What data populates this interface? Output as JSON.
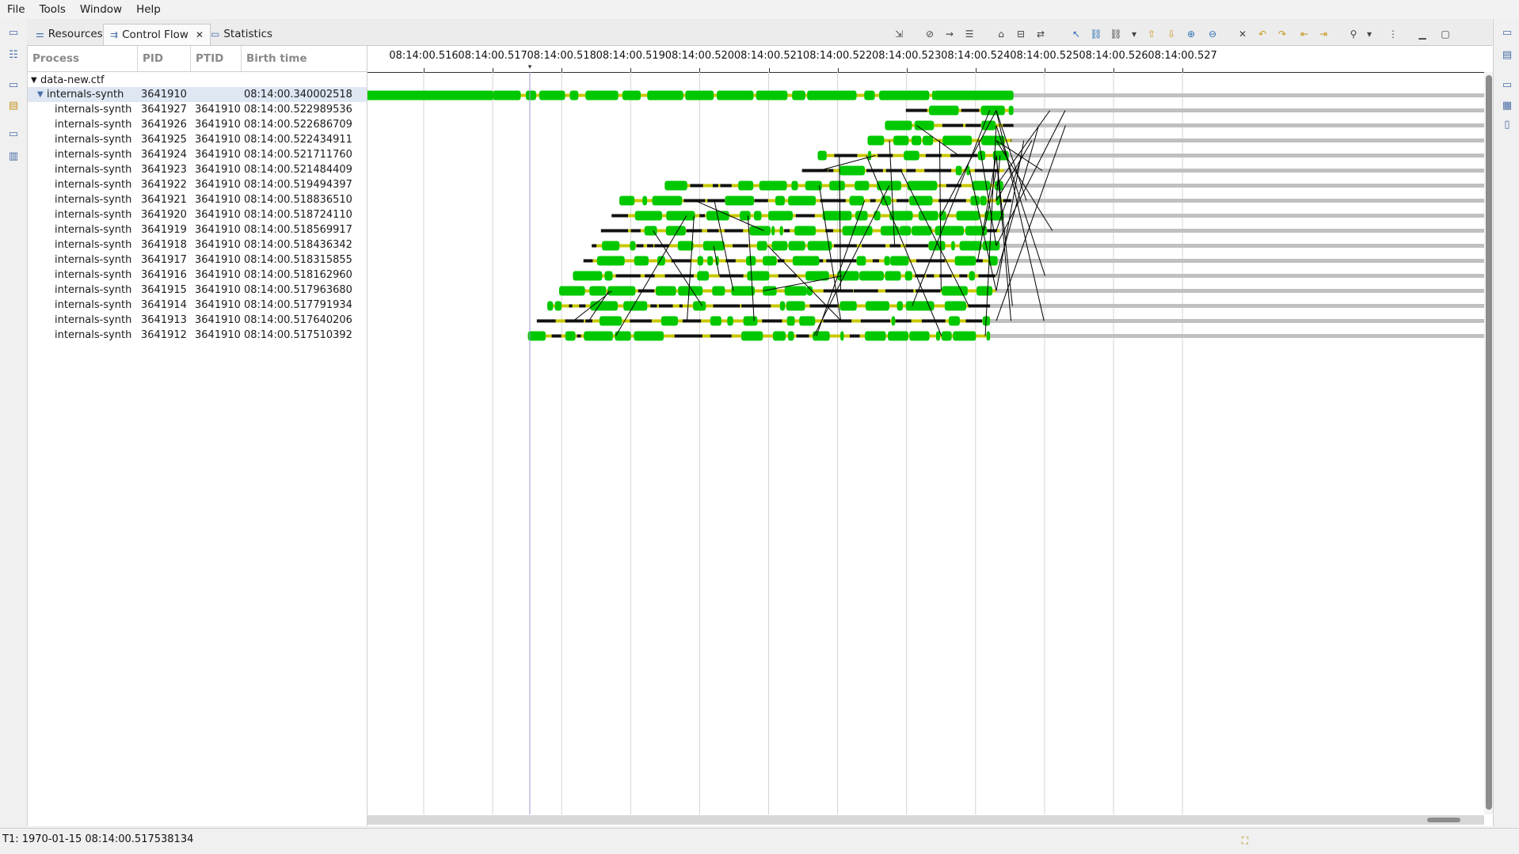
{
  "menu": [
    "File",
    "Tools",
    "Window",
    "Help"
  ],
  "tabs": [
    {
      "label": "Resources",
      "icon": "resources-icon"
    },
    {
      "label": "Control Flow",
      "icon": "control-flow-icon",
      "active": true
    },
    {
      "label": "Statistics",
      "icon": "statistics-icon"
    }
  ],
  "tree": {
    "headers": [
      "Process",
      "PID",
      "PTID",
      "Birth time"
    ],
    "trace": "data-new.ctf",
    "rows": [
      {
        "process": "internals-synth",
        "pid": "3641910",
        "ptid": "",
        "birth": "08:14:00.340002518",
        "parent": true,
        "start": 0.0,
        "end": 0.524
      },
      {
        "process": "internals-synth",
        "pid": "3641927",
        "ptid": "3641910",
        "birth": "08:14:00.522989536",
        "start": 0.522989536,
        "end": 0.52455
      },
      {
        "process": "internals-synth",
        "pid": "3641926",
        "ptid": "3641910",
        "birth": "08:14:00.522686709",
        "start": 0.522686709,
        "end": 0.52455
      },
      {
        "process": "internals-synth",
        "pid": "3641925",
        "ptid": "3641910",
        "birth": "08:14:00.522434911",
        "start": 0.522434911,
        "end": 0.52452
      },
      {
        "process": "internals-synth",
        "pid": "3641924",
        "ptid": "3641910",
        "birth": "08:14:00.521711760",
        "start": 0.52171176,
        "end": 0.52448
      },
      {
        "process": "internals-synth",
        "pid": "3641923",
        "ptid": "3641910",
        "birth": "08:14:00.521484409",
        "start": 0.521484409,
        "end": 0.52441
      },
      {
        "process": "internals-synth",
        "pid": "3641922",
        "ptid": "3641910",
        "birth": "08:14:00.519494397",
        "start": 0.519494397,
        "end": 0.5244
      },
      {
        "process": "internals-synth",
        "pid": "3641921",
        "ptid": "3641910",
        "birth": "08:14:00.518836510",
        "start": 0.51883651,
        "end": 0.52452
      },
      {
        "process": "internals-synth",
        "pid": "3641920",
        "ptid": "3641910",
        "birth": "08:14:00.518724110",
        "start": 0.51872411,
        "end": 0.52441
      },
      {
        "process": "internals-synth",
        "pid": "3641919",
        "ptid": "3641910",
        "birth": "08:14:00.518569917",
        "start": 0.518569917,
        "end": 0.52435
      },
      {
        "process": "internals-synth",
        "pid": "3641918",
        "ptid": "3641910",
        "birth": "08:14:00.518436342",
        "start": 0.518436342,
        "end": 0.52435
      },
      {
        "process": "internals-synth",
        "pid": "3641917",
        "ptid": "3641910",
        "birth": "08:14:00.518315855",
        "start": 0.518315855,
        "end": 0.52432
      },
      {
        "process": "internals-synth",
        "pid": "3641916",
        "ptid": "3641910",
        "birth": "08:14:00.518162960",
        "start": 0.51816296,
        "end": 0.52429
      },
      {
        "process": "internals-synth",
        "pid": "3641915",
        "ptid": "3641910",
        "birth": "08:14:00.517963680",
        "start": 0.51796368,
        "end": 0.52429
      },
      {
        "process": "internals-synth",
        "pid": "3641914",
        "ptid": "3641910",
        "birth": "08:14:00.517791934",
        "start": 0.517791934,
        "end": 0.52421
      },
      {
        "process": "internals-synth",
        "pid": "3641913",
        "ptid": "3641910",
        "birth": "08:14:00.517640206",
        "start": 0.517640206,
        "end": 0.52421
      },
      {
        "process": "internals-synth",
        "pid": "3641912",
        "ptid": "3641910",
        "birth": "08:14:00.517510392",
        "start": 0.517510392,
        "end": 0.52421
      }
    ]
  },
  "timescale": {
    "labels": [
      "08:14:00.516",
      "08:14:00.517",
      "08:14:00.518",
      "08:14:00.519",
      "08:14:00.520",
      "08:14:00.521",
      "08:14:00.522",
      "08:14:00.523",
      "08:14:00.524",
      "08:14:00.525",
      "08:14:00.526",
      "08:14:00.527"
    ],
    "seconds": [
      0.516,
      0.517,
      0.518,
      0.519,
      0.52,
      0.521,
      0.522,
      0.523,
      0.524,
      0.525,
      0.526,
      0.527
    ],
    "cursor": 0.5175381
  },
  "colors": {
    "running": "#00c800",
    "wait": "#c8c800",
    "unknown": "#c0c0c0",
    "arrow": "#000000",
    "cursor": "#9a9ad2"
  },
  "status": {
    "t1": "T1: 1970-01-15 08:14:00.517538134"
  },
  "toolbar_icons": [
    "export-icon",
    "filter-icon",
    "hide-arrows-icon",
    "legend-icon",
    "home-icon",
    "time-range-icon",
    "sync-icon",
    "select-icon",
    "link-icon",
    "unlink-icon",
    "dropdown-icon",
    "previous-icon",
    "next-icon",
    "zoom-in-icon",
    "zoom-out-icon",
    "remove-markers-icon",
    "prev-marker-icon",
    "next-marker-icon",
    "prev-event-icon",
    "next-event-icon",
    "pin-icon",
    "view-menu-icon",
    "more-icon",
    "minimize-icon",
    "maximize-icon"
  ]
}
